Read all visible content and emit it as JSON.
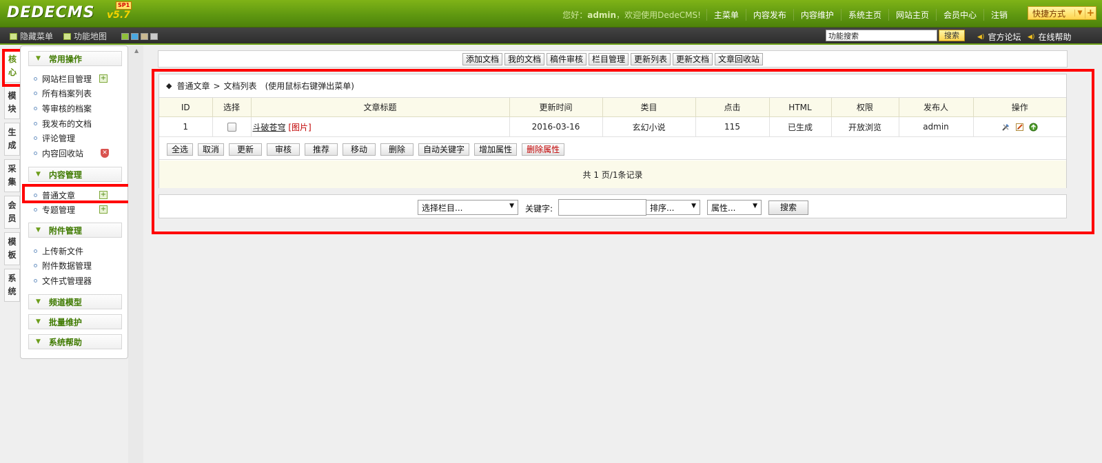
{
  "header": {
    "logo_text": "DEDECMS",
    "logo_version": "v5.7",
    "logo_badge": "SP1",
    "welcome_prefix": "您好：",
    "welcome_user": "admin",
    "welcome_suffix": "，欢迎使用DedeCMS!",
    "nav": [
      "主菜单",
      "内容发布",
      "内容维护",
      "系统主页",
      "网站主页",
      "会员中心",
      "注销"
    ],
    "quick_label": "快捷方式",
    "quick_plus": "+"
  },
  "subbar": {
    "hide_menu": "隐藏菜单",
    "function_map": "功能地图",
    "search_value": "功能搜索",
    "search_button": "搜索",
    "forum_link": "官方论坛",
    "help_link": "在线帮助",
    "swatch_colors": [
      "#8fc03a",
      "#4aa8e0",
      "#c8b890",
      "#c9c9c9"
    ]
  },
  "vtabs": [
    {
      "line1": "核",
      "line2": "心"
    },
    {
      "line1": "模",
      "line2": "块"
    },
    {
      "line1": "生",
      "line2": "成"
    },
    {
      "line1": "采",
      "line2": "集"
    },
    {
      "line1": "会",
      "line2": "员"
    },
    {
      "line1": "模",
      "line2": "板"
    },
    {
      "line1": "系",
      "line2": "统"
    }
  ],
  "menu": {
    "group_common": "常用操作",
    "common_items": [
      "网站栏目管理",
      "所有档案列表",
      "等审核的档案",
      "我发布的文档",
      "评论管理",
      "内容回收站"
    ],
    "group_content": "内容管理",
    "content_items": [
      "普通文章",
      "专题管理"
    ],
    "group_attach": "附件管理",
    "attach_items": [
      "上传新文件",
      "附件数据管理",
      "文件式管理器"
    ],
    "group_channel": "频道模型",
    "group_batch": "批量维护",
    "group_help": "系统帮助"
  },
  "toolbar": [
    "添加文档",
    "我的文档",
    "稿件审核",
    "栏目管理",
    "更新列表",
    "更新文档",
    "文章回收站"
  ],
  "breadcrumb": {
    "part1": "普通文章",
    "sep": ">",
    "part2": "文档列表",
    "hint": "(使用鼠标右键弹出菜单)"
  },
  "table": {
    "headers": [
      "ID",
      "选择",
      "文章标题",
      "更新时间",
      "类目",
      "点击",
      "HTML",
      "权限",
      "发布人",
      "操作"
    ],
    "rows": [
      {
        "id": "1",
        "title": "斗破苍穹",
        "tag": "[图片]",
        "updated": "2016-03-16",
        "category": "玄幻小说",
        "clicks": "115",
        "html": "已生成",
        "permission": "开放浏览",
        "publisher": "admin"
      }
    ]
  },
  "actions": [
    "全选",
    "取消",
    "更新",
    "审核",
    "推荐",
    "移动",
    "删除",
    "自动关键字",
    "增加属性",
    "删除属性"
  ],
  "pager": "共 1 页/1条记录",
  "search": {
    "column_select": "选择栏目...",
    "keyword_label": "关键字:",
    "keyword_value": "",
    "order_select": "排序...",
    "attr_select": "属性...",
    "button": "搜索"
  }
}
